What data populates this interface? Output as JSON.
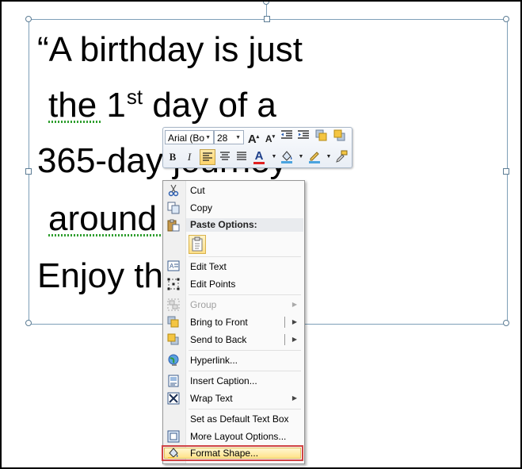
{
  "document": {
    "line1": "“A birthday is just",
    "line2_pre": "the 1",
    "line2_sup": "st",
    "line2_post": " day of a",
    "line3": "365-day journey",
    "line4": "around",
    "line5": "Enjoy th"
  },
  "mini_toolbar": {
    "font_name": "Arial (Bo",
    "font_size": "28",
    "icons": [
      "grow-font-icon",
      "shrink-font-icon",
      "decrease-indent-icon",
      "increase-indent-icon",
      "bring-forward-icon",
      "send-backward-icon",
      "bold-icon",
      "italic-icon",
      "align-left-icon",
      "center-icon",
      "font-color-icon",
      "shape-fill-icon",
      "shape-outline-icon",
      "format-painter-icon"
    ],
    "bold_glyph": "B",
    "italic_glyph": "I",
    "font_color_glyph": "A",
    "grow_glyph": "A",
    "shrink_glyph": "A"
  },
  "context_menu": {
    "cut": "Cut",
    "copy": "Copy",
    "paste_options": "Paste Options:",
    "edit_text": "Edit Text",
    "edit_points": "Edit Points",
    "group": "Group",
    "bring_to_front": "Bring to Front",
    "send_to_back": "Send to Back",
    "hyperlink": "Hyperlink...",
    "insert_caption": "Insert Caption...",
    "wrap_text": "Wrap Text",
    "set_default": "Set as Default Text Box",
    "more_layout": "More Layout Options...",
    "format_shape": "Format Shape..."
  },
  "colors": {
    "highlight_border": "#d04444",
    "menu_hover": "#ffe38a",
    "selection_border": "#7e9fb8",
    "spelling_squiggle": "#2f9e2f"
  }
}
